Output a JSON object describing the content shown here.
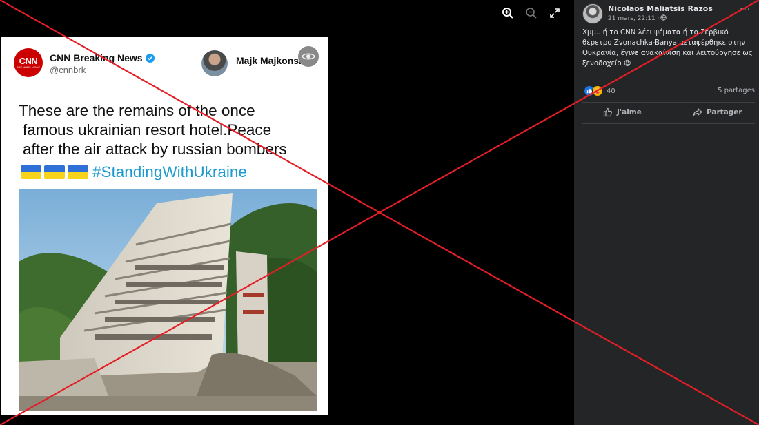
{
  "viewer": {
    "tools": [
      {
        "name": "zoom-in",
        "icon": "zoom-in-icon"
      },
      {
        "name": "zoom-out",
        "icon": "zoom-out-icon"
      },
      {
        "name": "fullscreen",
        "icon": "expand-icon"
      }
    ]
  },
  "card": {
    "cnn_logo_text": "CNN",
    "cnn_logo_sub": "BREAKING NEWS",
    "account_name": "CNN Breaking News",
    "account_handle": "@cnnbrk",
    "second_user": "Majk Majkonski",
    "headline_lines": [
      "These are the remains of the once",
      "famous ukrainian resort hotel.Peace",
      "after the air attack by russian bombers"
    ],
    "hashtag": "#StandingWithUkraine",
    "flag_colors": {
      "blue": "#2f6fd8",
      "yellow": "#f7d31b"
    }
  },
  "post": {
    "author": "Nicolaos Maliatsis Razos",
    "date": "21 mars, 22:11 ·",
    "privacy_icon": "globe-icon",
    "more": "···",
    "text": "Χμμ.. ή το CNN λέει ψέματα ή το Σερβικό θέρετρο Zvonachka-Banya μεταφέρθηκε στην Ουκρανία, έγινε ανακαίνιση και λειτούργησε ως ξενοδοχείο 😉",
    "reaction_count": "40",
    "shares": "5 partages",
    "like_label": "J'aime",
    "share_label": "Partager"
  },
  "colors": {
    "overlay_x": "#e41e26",
    "fb_like": "#1b74e4",
    "sidebar_bg": "#242526"
  }
}
